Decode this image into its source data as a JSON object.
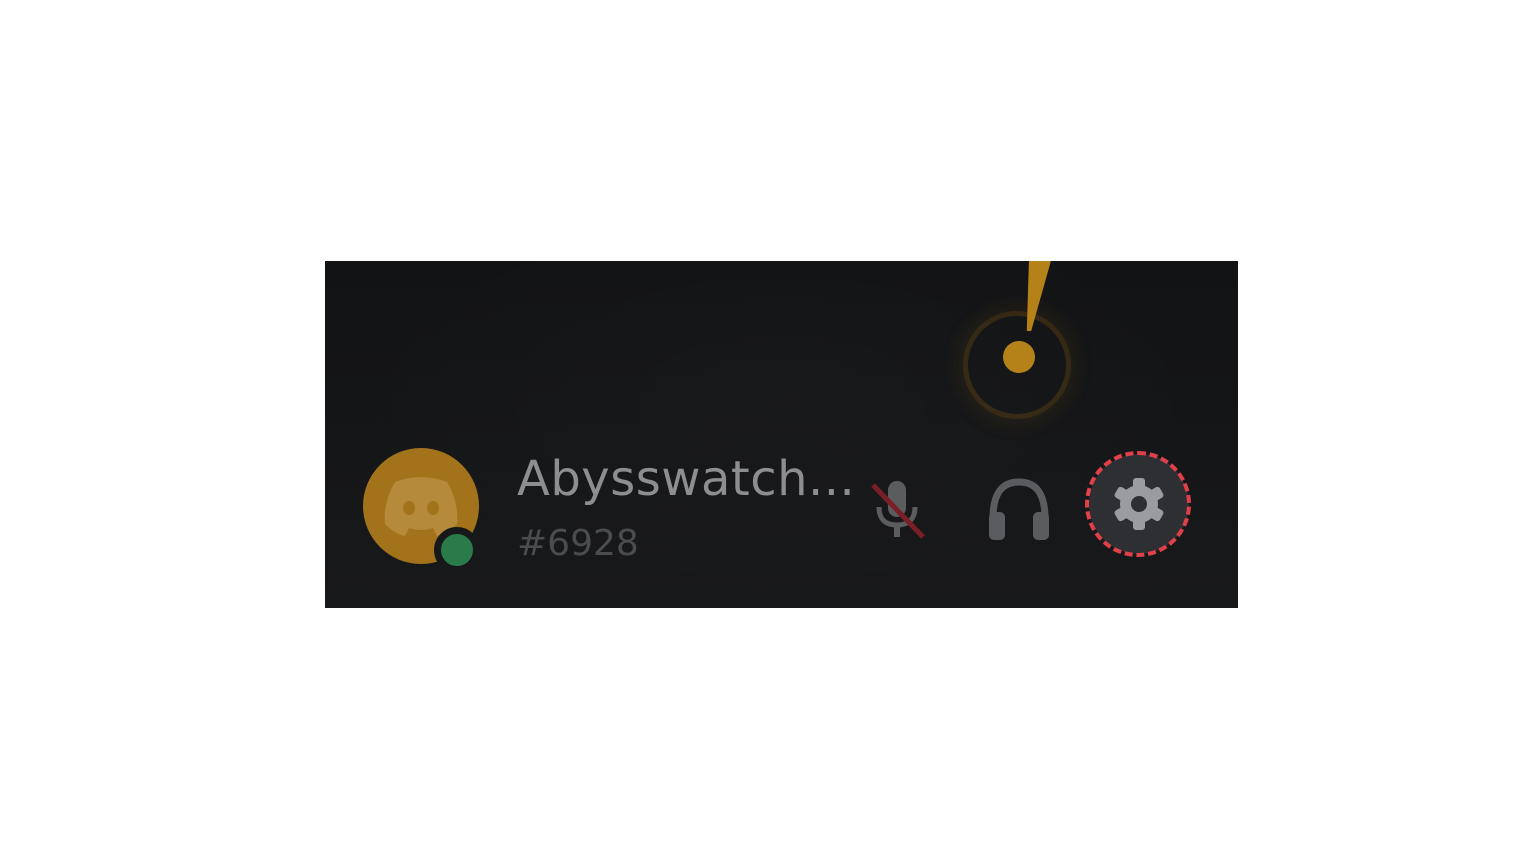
{
  "user_panel": {
    "username": "Abysswatch...",
    "discriminator": "#6928",
    "status": "online"
  },
  "controls": {
    "mute_icon": "microphone-muted-icon",
    "deafen_icon": "headphones-icon",
    "settings_icon": "gear-icon"
  },
  "colors": {
    "panel_bg": "#141517",
    "avatar_bg": "#a3731c",
    "status_online": "#2b7a4a",
    "highlight_ring": "#e0404a",
    "alert": "#b5821a"
  }
}
